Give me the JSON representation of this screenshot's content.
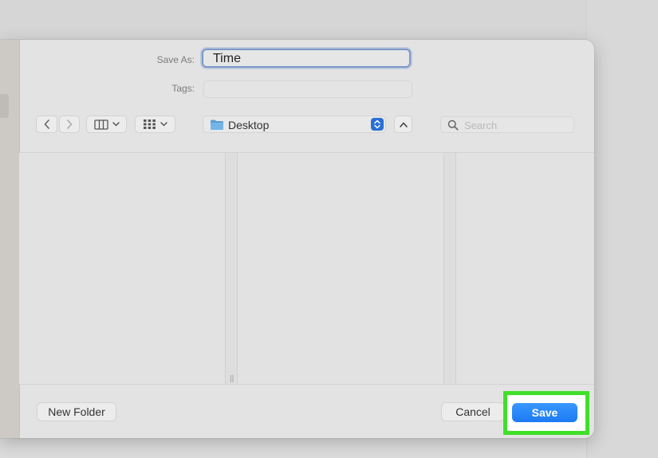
{
  "dialog": {
    "save_as_label": "Save As:",
    "file_name": "Time",
    "tags_label": "Tags:",
    "tags_value": ""
  },
  "toolbar": {
    "location": "Desktop",
    "search_placeholder": "Search"
  },
  "footer": {
    "new_folder_label": "New Folder",
    "cancel_label": "Cancel",
    "save_label": "Save"
  },
  "icons": {
    "back": "chevron-left-icon",
    "forward": "chevron-right-icon",
    "column_view": "column-view-icon",
    "group": "grid-icon",
    "folder": "folder-icon",
    "stepper": "up-down-arrows-icon",
    "expand": "chevron-up-icon",
    "search": "magnifier-icon"
  },
  "colors": {
    "accent": "#1c7af3",
    "highlight": "#3fe028",
    "field_focus": "#7a98c9"
  }
}
